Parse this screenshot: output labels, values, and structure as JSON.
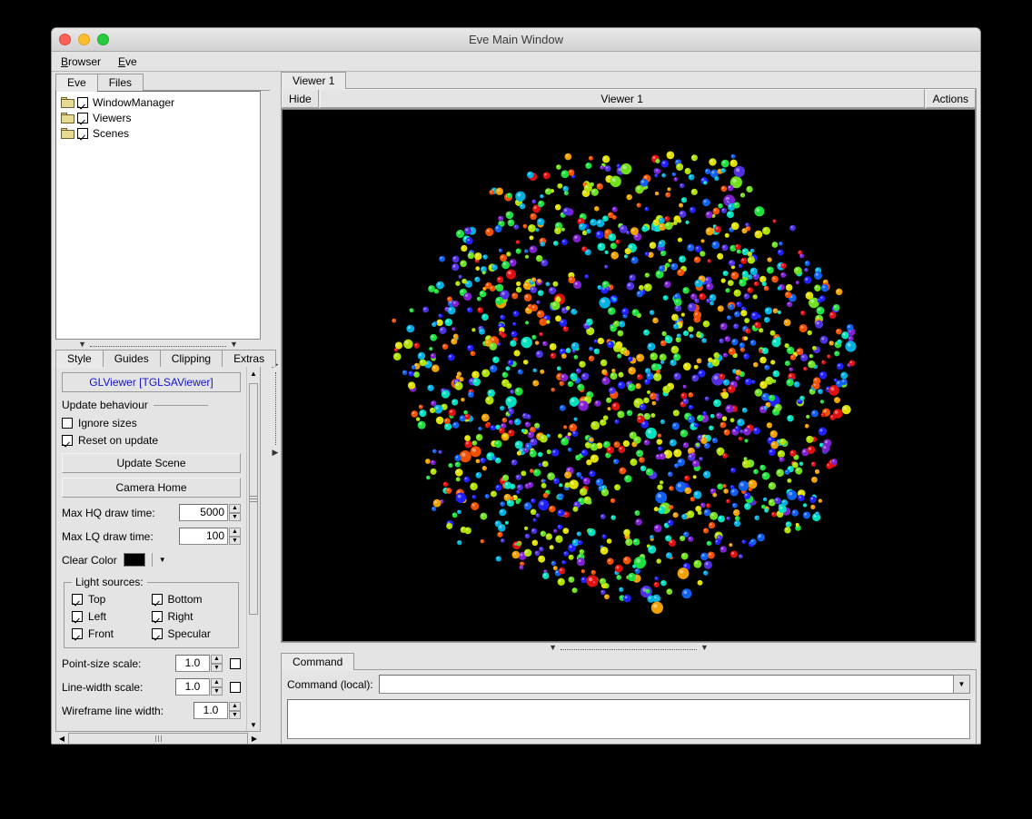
{
  "window": {
    "title": "Eve Main Window",
    "traffic_lights": [
      "close-red",
      "minimize-yellow",
      "maximize-green"
    ]
  },
  "menubar": {
    "items": [
      {
        "label": "Browser",
        "mnemonic": "B"
      },
      {
        "label": "Eve",
        "mnemonic": "E"
      }
    ]
  },
  "left_dock": {
    "browser_tabs": [
      {
        "label": "Eve",
        "active": true
      },
      {
        "label": "Files",
        "active": false
      }
    ],
    "tree": [
      {
        "label": "WindowManager",
        "checked": true,
        "icon": "folder-icon"
      },
      {
        "label": "Viewers",
        "checked": true,
        "icon": "folder-icon"
      },
      {
        "label": "Scenes",
        "checked": true,
        "icon": "folder-icon"
      }
    ],
    "editor_tabs": [
      {
        "label": "Style",
        "active": true
      },
      {
        "label": "Guides",
        "active": false
      },
      {
        "label": "Clipping",
        "active": false
      },
      {
        "label": "Extras",
        "active": false
      }
    ],
    "style": {
      "object_label": "GLViewer [TGLSAViewer]",
      "object_label_color": "#1414c8",
      "update_group_title": "Update behaviour",
      "ignore_sizes": {
        "label": "Ignore sizes",
        "checked": false
      },
      "reset_on_update": {
        "label": "Reset on update",
        "checked": true
      },
      "update_scene_button": "Update Scene",
      "camera_home_button": "Camera Home",
      "max_hq_draw_time": {
        "label": "Max HQ draw time:",
        "value": "5000"
      },
      "max_lq_draw_time": {
        "label": "Max LQ draw time:",
        "value": "100"
      },
      "clear_color": {
        "label": "Clear Color",
        "value": "#000000"
      },
      "light_sources": {
        "title": "Light sources:",
        "items": [
          {
            "label": "Top",
            "checked": true
          },
          {
            "label": "Bottom",
            "checked": true
          },
          {
            "label": "Left",
            "checked": true
          },
          {
            "label": "Right",
            "checked": true
          },
          {
            "label": "Front",
            "checked": true
          },
          {
            "label": "Specular",
            "checked": true
          }
        ]
      },
      "point_size_scale": {
        "label": "Point-size scale:",
        "value": "1.0",
        "toggle": false
      },
      "line_width_scale": {
        "label": "Line-width scale:",
        "value": "1.0",
        "toggle": false
      },
      "wireframe_line_width": {
        "label": "Wireframe line width:",
        "value": "1.0"
      }
    }
  },
  "viewer": {
    "tabs": [
      {
        "label": "Viewer 1",
        "active": true
      }
    ],
    "header": {
      "hide_button": "Hide",
      "title": "Viewer 1",
      "actions_button": "Actions"
    },
    "canvas": {
      "background": "#000000",
      "description": "3D point cloud of colored spheres"
    }
  },
  "command": {
    "tabs": [
      {
        "label": "Command",
        "active": true
      }
    ],
    "input_label": "Command (local):",
    "input_value": "",
    "input_placeholder": "",
    "dropdown_icon": "chevron-down-icon",
    "output_value": ""
  },
  "statusbar": {
    "cells": [
      "",
      "",
      "",
      ""
    ]
  },
  "chart_data": {
    "type": "scatter",
    "title": "Viewer 1",
    "xlabel": "",
    "ylabel": "",
    "background": "#000000",
    "point_count": 1400,
    "palette": [
      "#2020ff",
      "#1060f0",
      "#00b0e0",
      "#00e0c0",
      "#20e040",
      "#70e020",
      "#b0e000",
      "#e0e000",
      "#f0a000",
      "#f05000",
      "#e01010",
      "#8020d0",
      "#5030e0"
    ],
    "shape": "heptagonal-disc",
    "description": "Dense multicolored spherical markers arranged in a heptagonal projected volume with sparse boundary chains"
  }
}
